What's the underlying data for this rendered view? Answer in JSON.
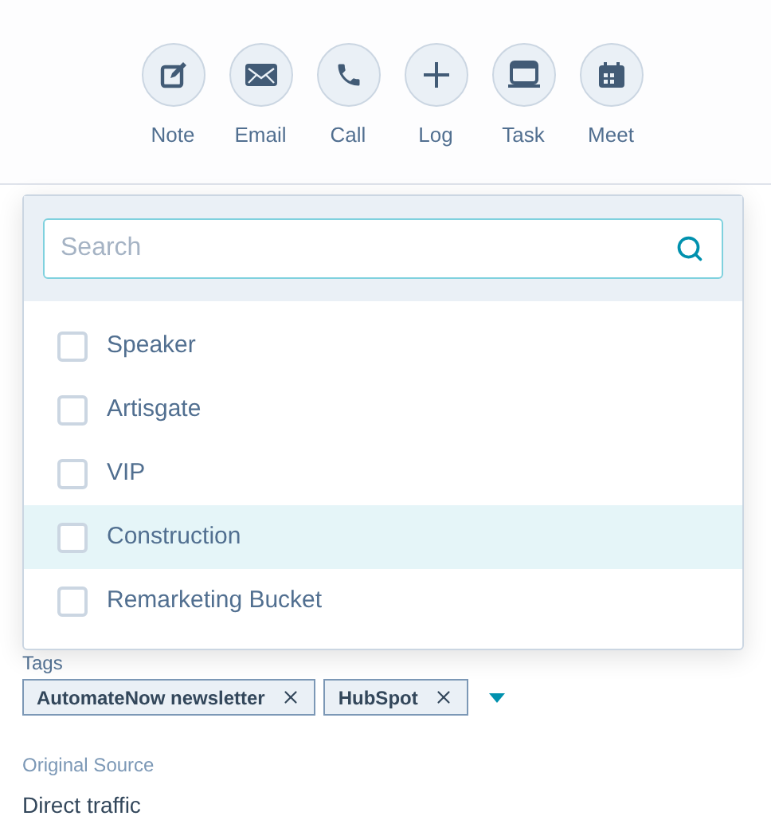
{
  "actions": [
    {
      "kind": "note",
      "label": "Note"
    },
    {
      "kind": "email",
      "label": "Email"
    },
    {
      "kind": "call",
      "label": "Call"
    },
    {
      "kind": "log",
      "label": "Log"
    },
    {
      "kind": "task",
      "label": "Task"
    },
    {
      "kind": "meet",
      "label": "Meet"
    }
  ],
  "dropdown": {
    "search": {
      "placeholder": "Search"
    },
    "options": [
      {
        "label": "Speaker",
        "checked": false,
        "highlighted": false
      },
      {
        "label": "Artisgate",
        "checked": false,
        "highlighted": false
      },
      {
        "label": "VIP",
        "checked": false,
        "highlighted": false
      },
      {
        "label": "Construction",
        "checked": false,
        "highlighted": true
      },
      {
        "label": "Remarketing Bucket",
        "checked": false,
        "highlighted": false
      }
    ]
  },
  "tags": {
    "label": "Tags",
    "chips": [
      "AutomateNow newsletter",
      "HubSpot"
    ]
  },
  "original_source": {
    "label": "Original Source",
    "value": "Direct traffic"
  }
}
